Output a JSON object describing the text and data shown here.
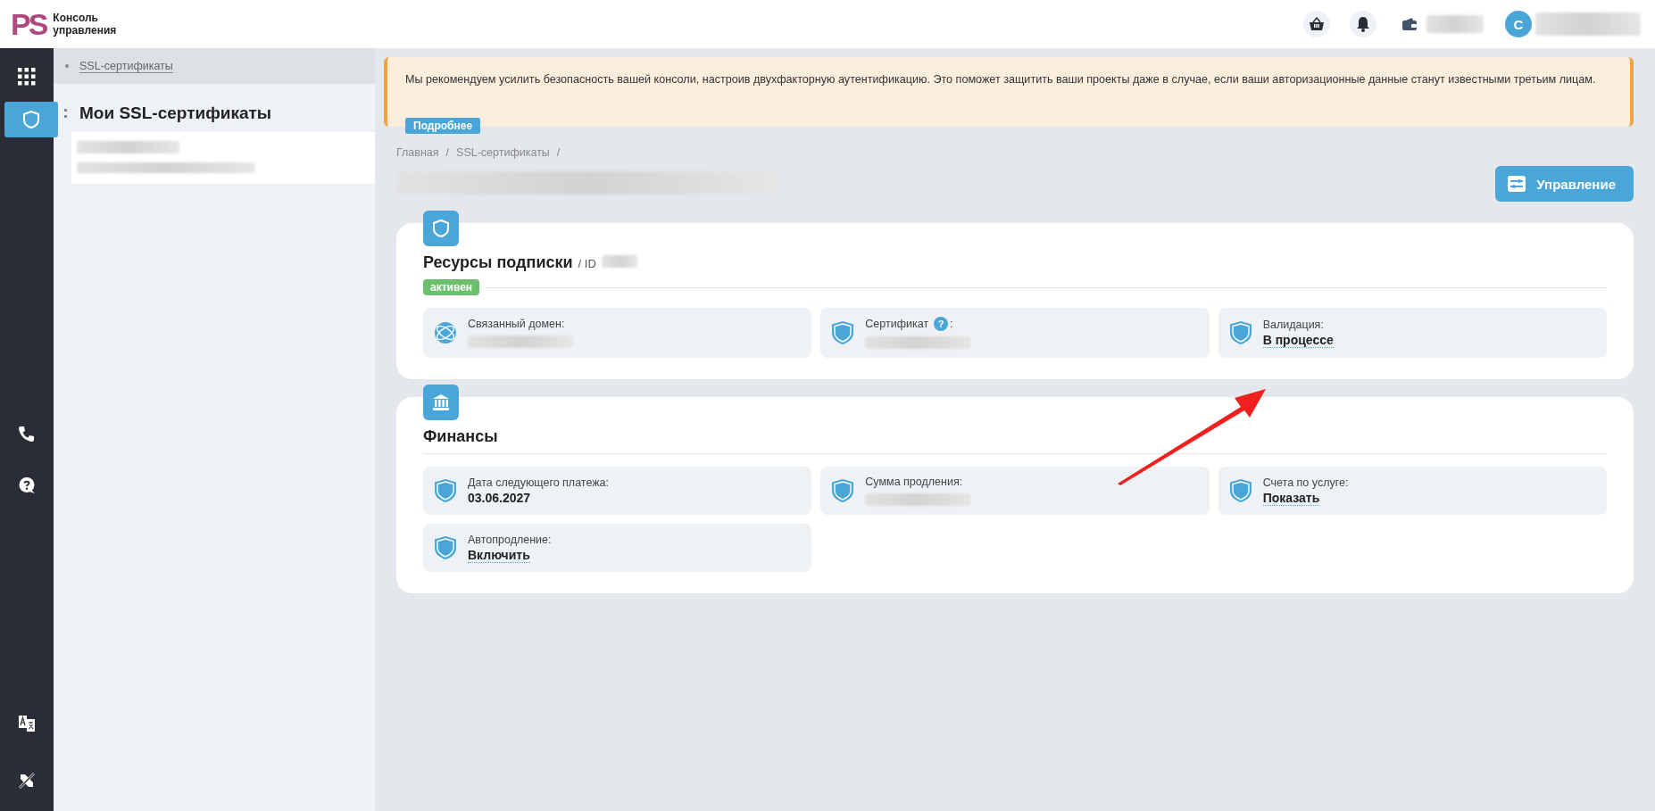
{
  "header": {
    "logo": "PS",
    "title": "Консоль управления",
    "avatar_letter": "С"
  },
  "rail": [
    {
      "kind": "grid",
      "selected": false
    },
    {
      "kind": "shield",
      "selected": true
    },
    {
      "kind": "phone",
      "selected": false
    },
    {
      "kind": "help",
      "selected": false
    },
    {
      "kind": "translate",
      "selected": false
    },
    {
      "kind": "tools",
      "selected": false
    }
  ],
  "sidebar": {
    "crumb": "SSL-сертификаты",
    "title": "Мои SSL-сертификаты"
  },
  "alert": {
    "text": "Мы рекомендуем усилить безопасность вашей консоли, настроив двухфакторную аутентификацию. Это поможет защитить ваши проекты даже в случае, если ваши авторизационные данные станут известными третьим лицам.",
    "button": "Подробнее"
  },
  "breadcrumbs": [
    {
      "label": "Главная",
      "separator": "/"
    },
    {
      "label": "SSL-сертификаты",
      "separator": "/"
    }
  ],
  "manage_button": "Управление",
  "sections": [
    {
      "kind": "shield",
      "title": "Ресурсы подписки",
      "subtitle": "/ ID",
      "status": {
        "label": "активен",
        "color": "#6cbf6c"
      },
      "tiles": [
        {
          "kind": "domain",
          "label": "Связанный домен:"
        },
        {
          "kind": "hidden",
          "label": "Сертификат",
          "help": "?",
          "label_end": ":"
        },
        {
          "kind": "link",
          "label": "Валидация:",
          "value": "В процессе"
        }
      ]
    },
    {
      "kind": "bank",
      "title": "Финансы",
      "tiles": [
        {
          "kind": "text",
          "label": "Дата следующего платежа:",
          "value": "03.06.2027"
        },
        {
          "kind": "hidden",
          "label": "Сумма продления:"
        },
        {
          "kind": "link",
          "label": "Счета по услуге:",
          "value": "Показать"
        },
        {
          "kind": "link",
          "label": "Автопродление:",
          "value": "Включить"
        }
      ]
    }
  ]
}
